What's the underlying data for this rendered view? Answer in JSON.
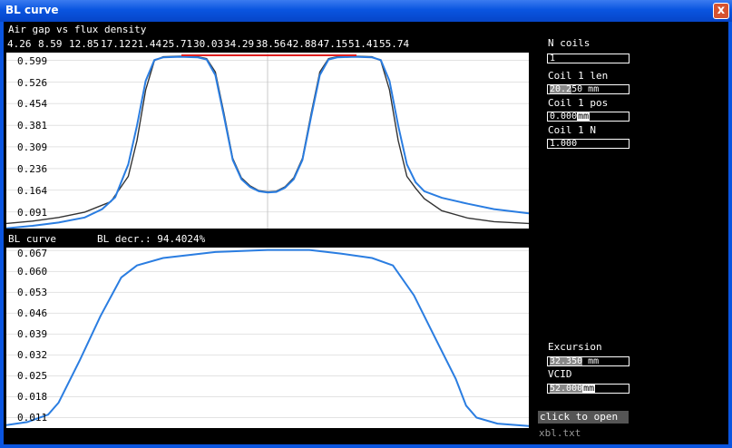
{
  "window": {
    "title": "BL curve",
    "close_glyph": "x"
  },
  "top_plot": {
    "title": "Air gap vs flux density",
    "x_ticks": [
      "4.26",
      "8.59",
      "12.85",
      "17.12",
      "21.44",
      "25.71",
      "30.03",
      "34.29",
      "38.56",
      "42.88",
      "47.15",
      "51.41",
      "55.74"
    ],
    "y_ticks": [
      "0.599",
      "0.526",
      "0.454",
      "0.381",
      "0.309",
      "0.236",
      "0.164",
      "0.091"
    ]
  },
  "bottom_plot": {
    "title": "BL curve",
    "bl_decr_label": "BL decr.: 94.4024%",
    "y_ticks": [
      "0.067",
      "0.060",
      "0.053",
      "0.046",
      "0.039",
      "0.032",
      "0.025",
      "0.018",
      "0.011"
    ]
  },
  "sidebar": {
    "n_coils_label": "N coils",
    "n_coils_value": "1",
    "coil1_len_label": "Coil 1 len",
    "coil1_len_selected": "20.2",
    "coil1_len_rest": "50",
    "coil1_len_unit": "mm",
    "coil1_pos_label": "Coil 1 pos",
    "coil1_pos_value": "0.000",
    "coil1_pos_unit": "mm",
    "coil1_n_label": "Coil 1 N",
    "coil1_n_value": "1.000",
    "excursion_label": "Excursion",
    "excursion_selected": "32.350",
    "excursion_unit": "mm",
    "vcid_label": "VCID",
    "vcid_selected": "52.000",
    "vcid_unit": "mm",
    "open_button": "click to open",
    "filename": "xbl.txt"
  },
  "colors": {
    "title_bar": "#0a55e0",
    "blue_curve": "#2a7de1",
    "dark_curve": "#333333",
    "red_marker": "#e02020"
  },
  "chart_data": [
    {
      "type": "line",
      "title": "Air gap vs flux density",
      "x_ticks": [
        4.26,
        8.59,
        12.85,
        17.12,
        21.44,
        25.71,
        30.03,
        34.29,
        38.56,
        42.88,
        47.15,
        51.41,
        55.74
      ],
      "y_ticks": [
        0.599,
        0.526,
        0.454,
        0.381,
        0.309,
        0.236,
        0.164,
        0.091
      ],
      "series": [
        {
          "color": "#333333",
          "points": [
            [
              0,
              0.052
            ],
            [
              3,
              0.06
            ],
            [
              6,
              0.072
            ],
            [
              9,
              0.09
            ],
            [
              12,
              0.125
            ],
            [
              14,
              0.21
            ],
            [
              15,
              0.33
            ],
            [
              16,
              0.5
            ],
            [
              17,
              0.598
            ],
            [
              18,
              0.611
            ],
            [
              20,
              0.613
            ],
            [
              22,
              0.611
            ],
            [
              23,
              0.605
            ],
            [
              24,
              0.56
            ],
            [
              25,
              0.42
            ],
            [
              26,
              0.27
            ],
            [
              27,
              0.205
            ],
            [
              28,
              0.178
            ],
            [
              29,
              0.162
            ],
            [
              30,
              0.158
            ],
            [
              31,
              0.16
            ],
            [
              32,
              0.175
            ],
            [
              33,
              0.205
            ],
            [
              34,
              0.27
            ],
            [
              35,
              0.42
            ],
            [
              36,
              0.56
            ],
            [
              37,
              0.605
            ],
            [
              38,
              0.611
            ],
            [
              40,
              0.613
            ],
            [
              42,
              0.611
            ],
            [
              43,
              0.598
            ],
            [
              44,
              0.5
            ],
            [
              45,
              0.33
            ],
            [
              46,
              0.21
            ],
            [
              47,
              0.17
            ],
            [
              48,
              0.135
            ],
            [
              50,
              0.095
            ],
            [
              53,
              0.07
            ],
            [
              56,
              0.058
            ],
            [
              60,
              0.052
            ]
          ]
        },
        {
          "color": "#2a7de1",
          "points": [
            [
              0,
              0.036
            ],
            [
              3,
              0.044
            ],
            [
              6,
              0.055
            ],
            [
              9,
              0.072
            ],
            [
              11,
              0.1
            ],
            [
              12.5,
              0.14
            ],
            [
              14,
              0.25
            ],
            [
              15,
              0.38
            ],
            [
              16,
              0.53
            ],
            [
              17,
              0.6
            ],
            [
              18,
              0.609
            ],
            [
              20,
              0.611
            ],
            [
              22,
              0.609
            ],
            [
              23,
              0.602
            ],
            [
              24,
              0.55
            ],
            [
              25,
              0.41
            ],
            [
              26,
              0.265
            ],
            [
              27,
              0.2
            ],
            [
              28,
              0.174
            ],
            [
              29,
              0.16
            ],
            [
              30,
              0.156
            ],
            [
              31,
              0.158
            ],
            [
              32,
              0.172
            ],
            [
              33,
              0.2
            ],
            [
              34,
              0.265
            ],
            [
              35,
              0.41
            ],
            [
              36,
              0.55
            ],
            [
              37,
              0.602
            ],
            [
              38,
              0.609
            ],
            [
              40,
              0.611
            ],
            [
              42,
              0.609
            ],
            [
              43,
              0.6
            ],
            [
              44,
              0.53
            ],
            [
              45,
              0.38
            ],
            [
              46,
              0.25
            ],
            [
              47,
              0.19
            ],
            [
              48,
              0.16
            ],
            [
              50,
              0.138
            ],
            [
              53,
              0.118
            ],
            [
              56,
              0.1
            ],
            [
              60,
              0.086
            ]
          ]
        }
      ]
    },
    {
      "type": "line",
      "title": "BL curve",
      "y_ticks": [
        0.067,
        0.06,
        0.053,
        0.046,
        0.039,
        0.032,
        0.025,
        0.018,
        0.011
      ],
      "series": [
        {
          "color": "#2a7de1",
          "points": [
            [
              0,
              0.0085
            ],
            [
              4,
              0.0095
            ],
            [
              8,
              0.012
            ],
            [
              10,
              0.016
            ],
            [
              14,
              0.03
            ],
            [
              18,
              0.045
            ],
            [
              22,
              0.058
            ],
            [
              25,
              0.062
            ],
            [
              30,
              0.0645
            ],
            [
              40,
              0.0665
            ],
            [
              50,
              0.0672
            ],
            [
              58,
              0.0672
            ],
            [
              64,
              0.066
            ],
            [
              70,
              0.0645
            ],
            [
              74,
              0.062
            ],
            [
              78,
              0.052
            ],
            [
              82,
              0.038
            ],
            [
              86,
              0.024
            ],
            [
              88,
              0.015
            ],
            [
              90,
              0.011
            ],
            [
              94,
              0.009
            ],
            [
              100,
              0.0082
            ]
          ]
        }
      ]
    }
  ]
}
